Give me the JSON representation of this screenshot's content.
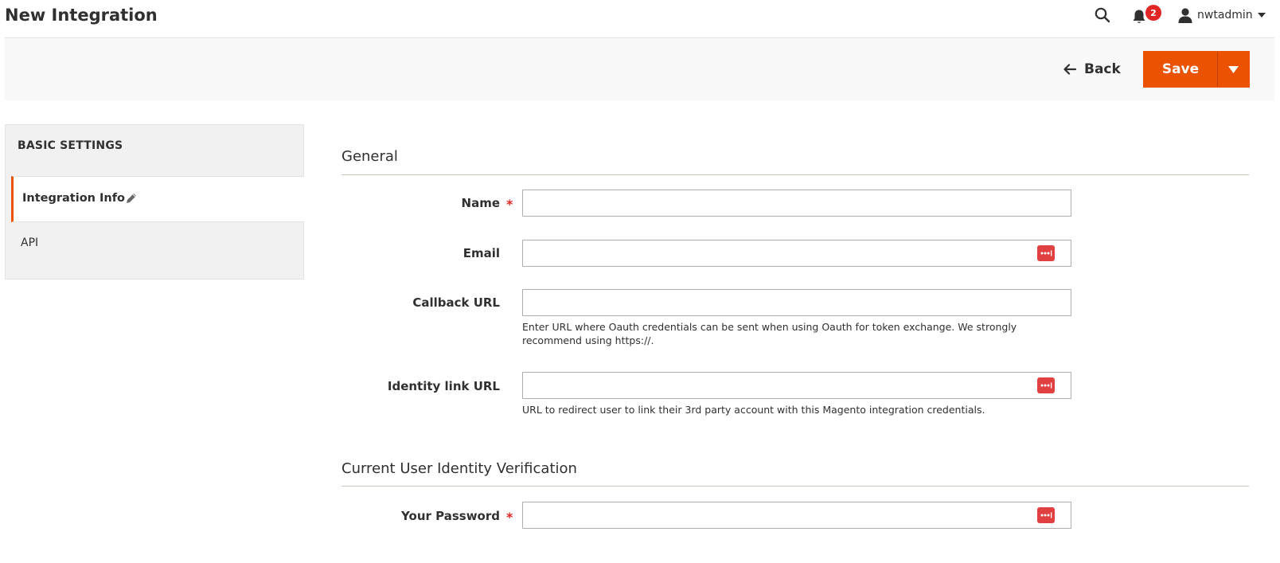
{
  "header": {
    "title": "New Integration",
    "notifications_count": "2",
    "username": "nwtadmin"
  },
  "toolbar": {
    "back_label": "Back",
    "save_label": "Save"
  },
  "sidebar": {
    "title": "BASIC SETTINGS",
    "tabs": [
      {
        "label": "Integration Info",
        "active": true
      },
      {
        "label": "API",
        "active": false
      }
    ]
  },
  "form": {
    "general_title": "General",
    "fields": {
      "name": {
        "label": "Name",
        "value": "",
        "required": true
      },
      "email": {
        "label": "Email",
        "value": ""
      },
      "callback_url": {
        "label": "Callback URL",
        "value": "",
        "note": "Enter URL where Oauth credentials can be sent when using Oauth for token exchange. We strongly recommend using https://."
      },
      "identity_link_url": {
        "label": "Identity link URL",
        "value": "",
        "note": "URL to redirect user to link their 3rd party account with this Magento integration credentials."
      }
    },
    "verification_title": "Current User Identity Verification",
    "password": {
      "label": "Your Password",
      "value": "",
      "required": true
    },
    "required_marker": "*"
  },
  "icons": {
    "search": "search-icon",
    "bell": "bell-icon",
    "user": "user-icon",
    "back": "arrow-left-icon",
    "pencil": "pencil-icon",
    "password_manager": "password-manager-icon"
  },
  "colors": {
    "accent": "#eb5202",
    "badge": "#e22626",
    "required": "#e22626"
  }
}
